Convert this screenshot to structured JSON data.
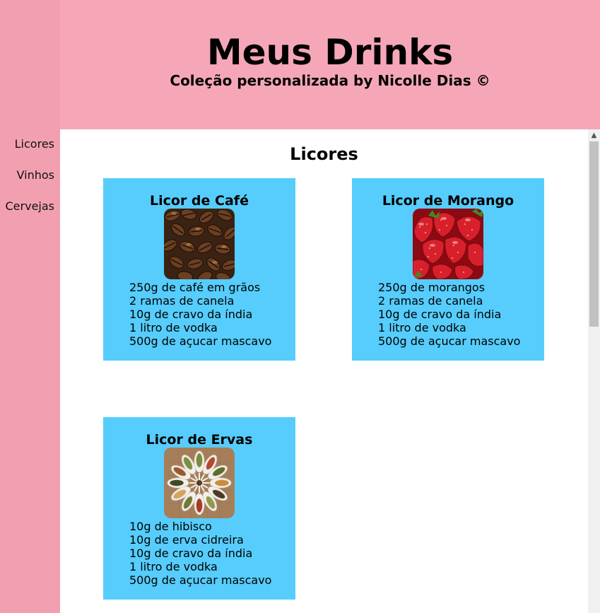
{
  "header": {
    "title": "Meus Drinks",
    "subtitle": "Coleção personalizada by Nicolle Dias ©"
  },
  "sidebar": {
    "items": [
      {
        "label": "Licores"
      },
      {
        "label": "Vinhos"
      },
      {
        "label": "Cervejas"
      }
    ]
  },
  "main": {
    "section_title": "Licores",
    "cards": [
      {
        "title": "Licor de Café",
        "image_icon": "coffee-beans-image",
        "ingredients": [
          "250g de café em grãos",
          "2 ramas de canela",
          "10g de cravo da índia",
          "1 litro de vodka",
          "500g de açucar mascavo"
        ]
      },
      {
        "title": "Licor de Morango",
        "image_icon": "strawberries-image",
        "ingredients": [
          "250g de morangos",
          "2 ramas de canela",
          "10g de cravo da índia",
          "1 litro de vodka",
          "500g de açucar mascavo"
        ]
      },
      {
        "title": "Licor de Ervas",
        "image_icon": "herbs-spoons-image",
        "ingredients": [
          "10g de hibisco",
          "10g de erva cidreira",
          "10g de cravo da índia",
          "1 litro de vodka",
          "500g de açucar mascavo"
        ]
      }
    ]
  },
  "colors": {
    "sidebar_bg": "#f2a0b0",
    "header_bg": "#f6a7b7",
    "card_bg": "#56cdfc"
  }
}
